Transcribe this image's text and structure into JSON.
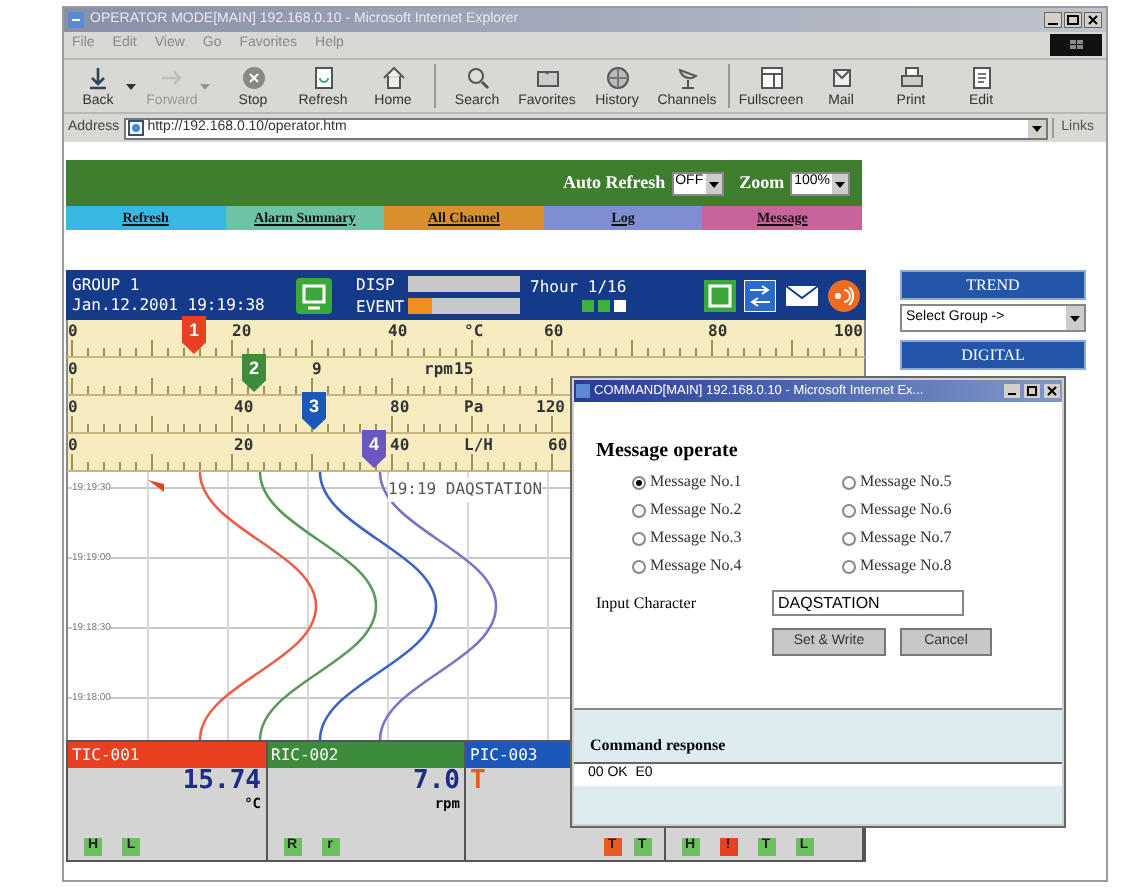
{
  "window": {
    "title": "OPERATOR MODE[MAIN] 192.168.0.10 - Microsoft Internet Explorer"
  },
  "menu": [
    "File",
    "Edit",
    "View",
    "Go",
    "Favorites",
    "Help"
  ],
  "toolbar": [
    {
      "label": "Back",
      "disabled": false,
      "dropdown": true
    },
    {
      "label": "Forward",
      "disabled": true,
      "dropdown": true
    },
    {
      "label": "Stop",
      "disabled": false,
      "dropdown": false
    },
    {
      "label": "Refresh",
      "disabled": false,
      "dropdown": false
    },
    {
      "label": "Home",
      "disabled": false,
      "dropdown": false
    },
    {
      "label": "Search",
      "disabled": false,
      "dropdown": false
    },
    {
      "label": "Favorites",
      "disabled": false,
      "dropdown": false
    },
    {
      "label": "History",
      "disabled": false,
      "dropdown": false
    },
    {
      "label": "Channels",
      "disabled": false,
      "dropdown": false
    },
    {
      "label": "Fullscreen",
      "disabled": false,
      "dropdown": false
    },
    {
      "label": "Mail",
      "disabled": false,
      "dropdown": false
    },
    {
      "label": "Print",
      "disabled": false,
      "dropdown": false
    },
    {
      "label": "Edit",
      "disabled": false,
      "dropdown": false
    }
  ],
  "address": {
    "label": "Address",
    "value": "http://192.168.0.10/operator.htm",
    "links": "Links"
  },
  "page": {
    "auto_refresh": {
      "label": "Auto Refresh",
      "value": "OFF"
    },
    "zoom": {
      "label": "Zoom",
      "value": "100%"
    },
    "nav": [
      {
        "label": "Refresh",
        "color": "#38b8e0"
      },
      {
        "label": "Alarm Summary",
        "color": "#6cc4a4"
      },
      {
        "label": "All Channel",
        "color": "#d8902c"
      },
      {
        "label": "Log",
        "color": "#7e8ed0"
      },
      {
        "label": "Message",
        "color": "#c8649c"
      }
    ],
    "display": {
      "group": "GROUP 1",
      "datetime": "Jan.12.2001 19:19:38",
      "meters": [
        {
          "label": "DISP",
          "level": 0
        },
        {
          "label": "EVENT",
          "level": 0.22
        }
      ],
      "span": "7hour 1/16",
      "indicators": [
        {
          "on": true
        },
        {
          "on": true
        },
        {
          "on": false
        }
      ],
      "scales": [
        {
          "labels": [
            "0",
            "20",
            "40",
            "°C",
            "60",
            "80",
            "100"
          ],
          "marker": {
            "text": "1",
            "color": "#e84020"
          }
        },
        {
          "labels": [
            "0",
            "9",
            "rpm",
            "15"
          ],
          "marker": {
            "text": "2",
            "color": "#3c8c3c"
          }
        },
        {
          "labels": [
            "0",
            "40",
            "80",
            "Pa",
            "120"
          ],
          "marker": {
            "text": "3",
            "color": "#1c58b8"
          }
        },
        {
          "labels": [
            "0",
            "20",
            "40",
            "L/H",
            "60"
          ],
          "marker": {
            "text": "4",
            "color": "#6a58c0"
          }
        }
      ],
      "times": [
        "19:19:30",
        "19:19:00",
        "19:18:30",
        "19:18:00"
      ],
      "message": "19:19 DAQSTATION",
      "traces": [
        {
          "color": "#e86048"
        },
        {
          "color": "#5a9a5a"
        },
        {
          "color": "#3a64c4"
        },
        {
          "color": "#8070c8"
        }
      ],
      "channels": [
        {
          "tag": "TIC-001",
          "color": "#e84020",
          "value": "15.74",
          "unit": "°C",
          "alarm": false,
          "badges": [
            {
              "text": "H",
              "color": "#6cc060"
            },
            {
              "text": "L",
              "color": "#6cc060"
            }
          ]
        },
        {
          "tag": "RIC-002",
          "color": "#3c8c3c",
          "value": "7.0",
          "unit": "rpm",
          "alarm": false,
          "badges": [
            {
              "text": "R",
              "color": "#6cc060"
            },
            {
              "text": "r",
              "color": "#6cc060"
            }
          ]
        },
        {
          "tag": "PIC-003",
          "color": "#1c58b8",
          "value": "T",
          "alarm": true,
          "badges": [
            {
              "text": "T",
              "color": "#e85a20"
            },
            {
              "text": "T",
              "color": "#6cc060"
            }
          ]
        },
        {
          "badges": [
            {
              "text": "H",
              "color": "#6cc060"
            },
            {
              "text": "!",
              "color": "#e84020"
            },
            {
              "text": "T",
              "color": "#6cc060"
            },
            {
              "text": "L",
              "color": "#6cc060"
            }
          ]
        }
      ]
    },
    "side_panel": {
      "trend": "TREND",
      "group_select": "Select Group ->",
      "digital": "DIGITAL"
    }
  },
  "dialog": {
    "title": "COMMAND[MAIN] 192.168.0.10 - Microsoft Internet Ex...",
    "heading": "Message operate",
    "options": [
      {
        "label": "Message No.1",
        "selected": true
      },
      {
        "label": "Message No.2",
        "selected": false
      },
      {
        "label": "Message No.3",
        "selected": false
      },
      {
        "label": "Message No.4",
        "selected": false
      },
      {
        "label": "Message No.5",
        "selected": false
      },
      {
        "label": "Message No.6",
        "selected": false
      },
      {
        "label": "Message No.7",
        "selected": false
      },
      {
        "label": "Message No.8",
        "selected": false
      }
    ],
    "input_label": "Input Character",
    "input_value": "DAQSTATION",
    "buttons": [
      "Set & Write",
      "Cancel"
    ],
    "response_label": "Command response",
    "response_value": "00 OK  E0"
  }
}
